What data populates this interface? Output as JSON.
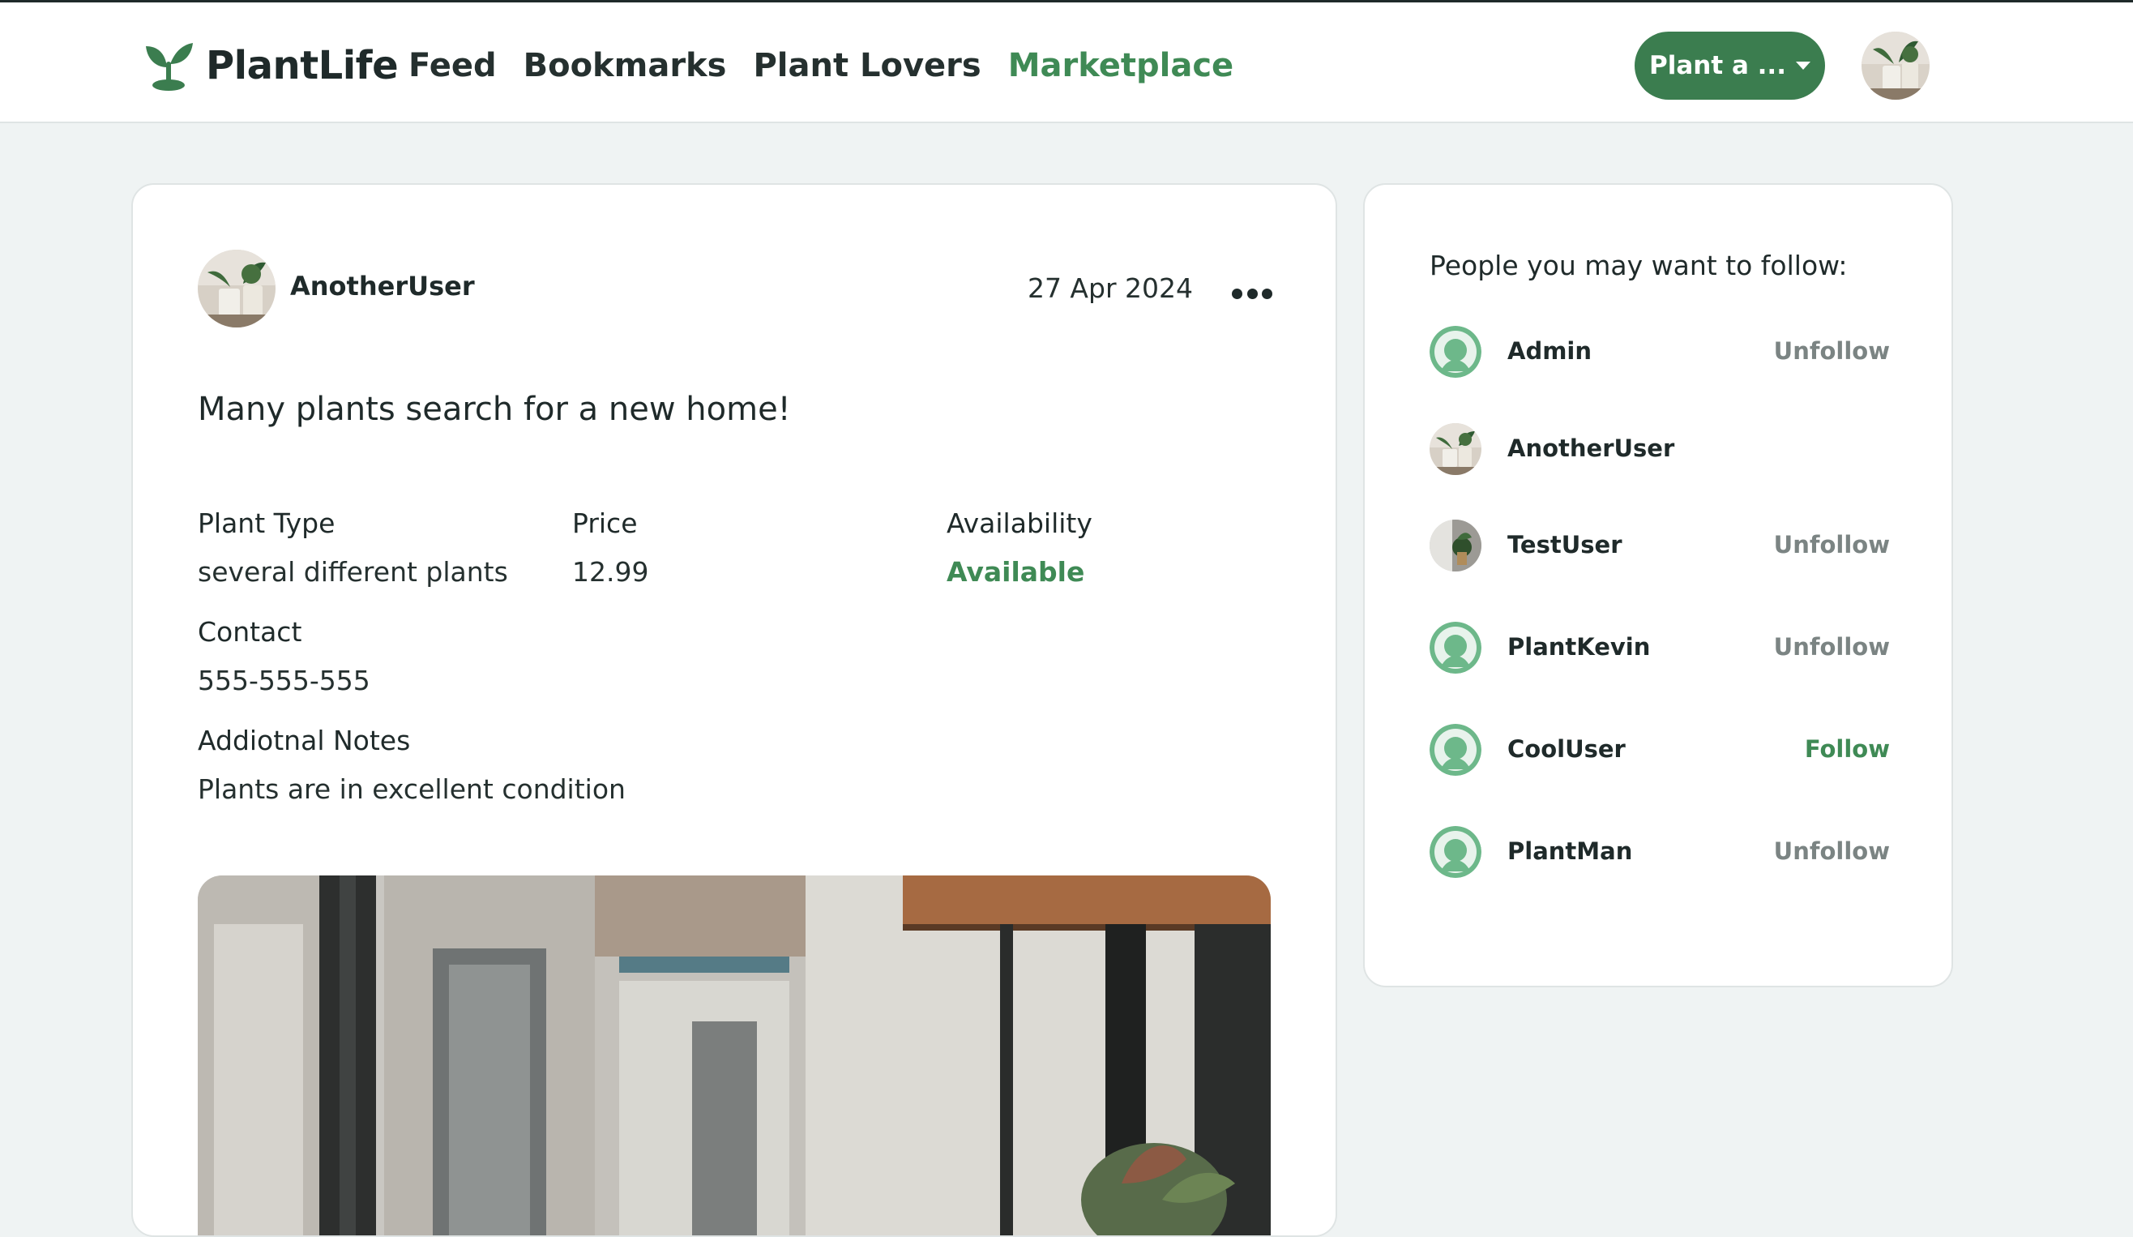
{
  "brand": {
    "name": "PlantLife",
    "accent_color": "#3b7d4f",
    "icon": "sprout-icon"
  },
  "nav": {
    "links": [
      {
        "label": "Feed",
        "active": false
      },
      {
        "label": "Bookmarks",
        "active": false
      },
      {
        "label": "Plant Lovers",
        "active": false
      },
      {
        "label": "Marketplace",
        "active": true
      }
    ],
    "plant_button_label": "Plant a ...",
    "avatar_icon": "user-avatar"
  },
  "post": {
    "author": "AnotherUser",
    "date": "27 Apr 2024",
    "more_icon": "more-dots-icon",
    "title": "Many plants search for a new home!",
    "fields": {
      "plant_type_label": "Plant Type",
      "plant_type_value": "several different plants",
      "price_label": "Price",
      "price_value": "12.99",
      "availability_label": "Availability",
      "availability_value": "Available",
      "contact_label": "Contact",
      "contact_value": "555-555-555",
      "notes_label": "Addiotnal Notes",
      "notes_value": "Plants are in excellent condition"
    }
  },
  "sidebar": {
    "title": "People you may want to follow:",
    "users": [
      {
        "name": "Admin",
        "action": "Unfollow",
        "avatar": "default-avatar"
      },
      {
        "name": "AnotherUser",
        "action": "",
        "avatar": "plant-photo-avatar"
      },
      {
        "name": "TestUser",
        "action": "Unfollow",
        "avatar": "plant-photo-avatar"
      },
      {
        "name": "PlantKevin",
        "action": "Unfollow",
        "avatar": "default-avatar"
      },
      {
        "name": "CoolUser",
        "action": "Follow",
        "avatar": "default-avatar"
      },
      {
        "name": "PlantMan",
        "action": "Unfollow",
        "avatar": "default-avatar"
      }
    ]
  },
  "colors": {
    "background": "#eff3f3",
    "follow_green": "#3f8a55",
    "unfollow_gray": "#7b8483",
    "default_avatar": "#6db88a"
  }
}
